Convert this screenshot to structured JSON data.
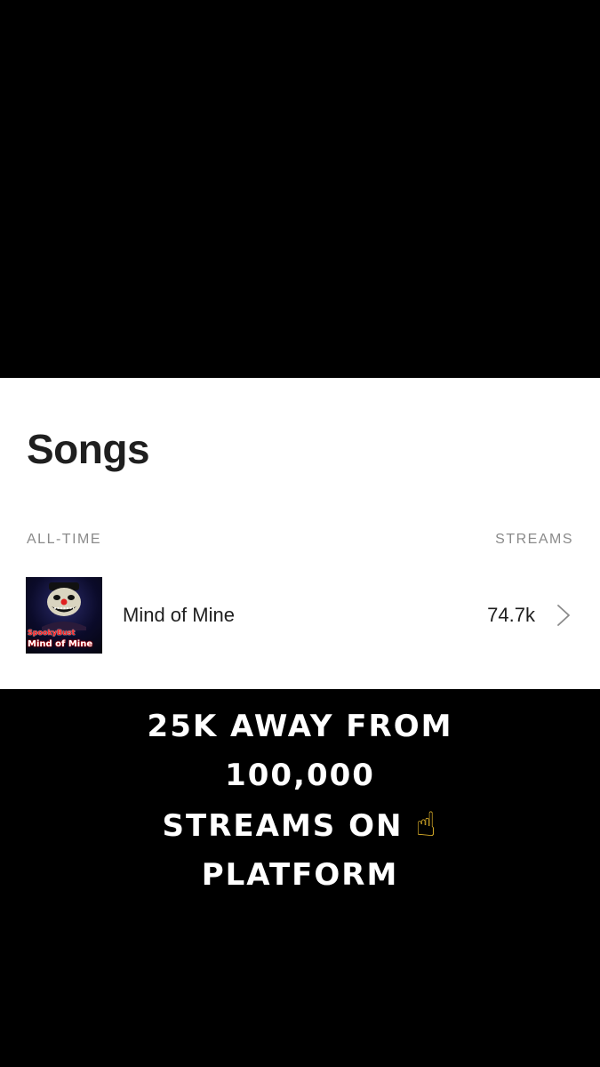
{
  "songs_section": {
    "title": "Songs",
    "left_header": "ALL-TIME",
    "right_header": "STREAMS",
    "rows": [
      {
        "title": "Mind of Mine",
        "streams": "74.7k",
        "cover_artist": "SpookyBust",
        "cover_title": "Mind of Mine"
      }
    ]
  },
  "caption": {
    "line1": "25K AWAY FROM",
    "line2": "100,000",
    "line3": "STREAMS ON",
    "line3_emoji": "☝",
    "line4": "PLATFORM"
  },
  "colors": {
    "background": "#000000",
    "card": "#ffffff",
    "text": "#1f1f1f",
    "muted": "#8a8a8a"
  }
}
